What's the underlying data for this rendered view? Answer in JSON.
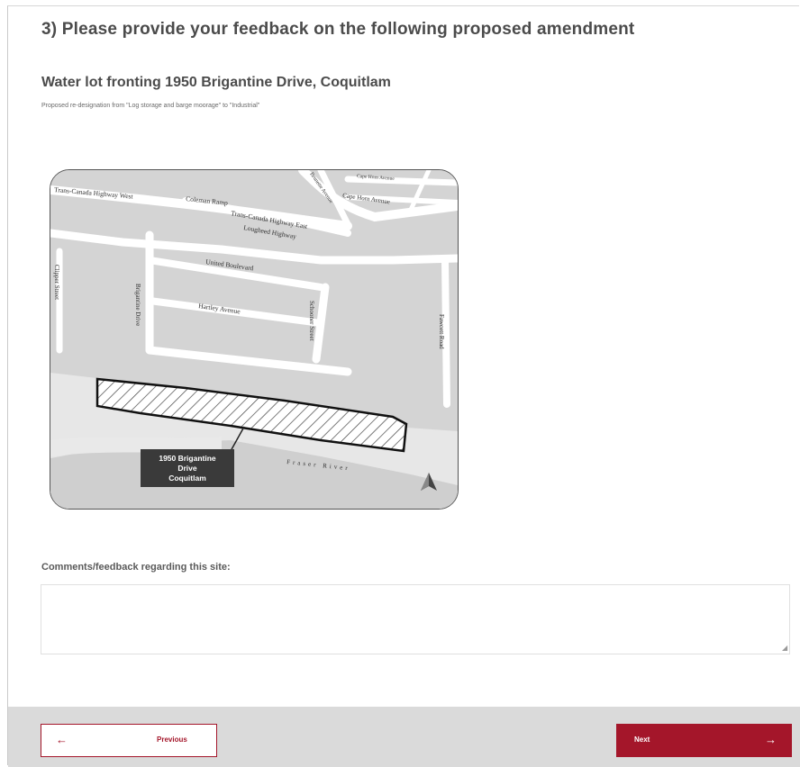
{
  "question": {
    "title": "3) Please provide your feedback on the following proposed amendment"
  },
  "site": {
    "title": "Water lot fronting 1950 Brigantine Drive, Coquitlam",
    "description": "Proposed re-designation from \"Log storage and barge moorage\" to \"Industrial\""
  },
  "map": {
    "streets": {
      "trans_canada_west": "Trans-Canada Highway West",
      "coleman_ramp": "Coleman Ramp",
      "trans_canada_east": "Trans-Canada Highway East",
      "lougheed": "Lougheed Highway",
      "united": "United Boulevard",
      "cape_horn": "Cape Horn Avenue",
      "cape_horn_top": "Cape Horn Avenue",
      "brunette": "Brunette Avenue",
      "clipper": "Clipper Street",
      "brigantine": "Brigantine Drive",
      "hartley": "Hartley Avenue",
      "schooner": "Schooner Street",
      "fawcett": "Fawcett Road"
    },
    "river_label": "Fraser River",
    "site_callout": [
      "1950 Brigantine",
      "Drive",
      "Coquitlam"
    ],
    "north_icon": "north-arrow-icon"
  },
  "comments": {
    "label": "Comments/feedback regarding this site:",
    "value": "",
    "placeholder": ""
  },
  "nav": {
    "previous_label": "Previous",
    "next_label": "Next",
    "previous_icon": "arrow-left-icon",
    "next_icon": "arrow-right-icon"
  },
  "colors": {
    "accent": "#a4162a",
    "footer_bg": "#dadada",
    "title_text": "#4b4b4b"
  }
}
